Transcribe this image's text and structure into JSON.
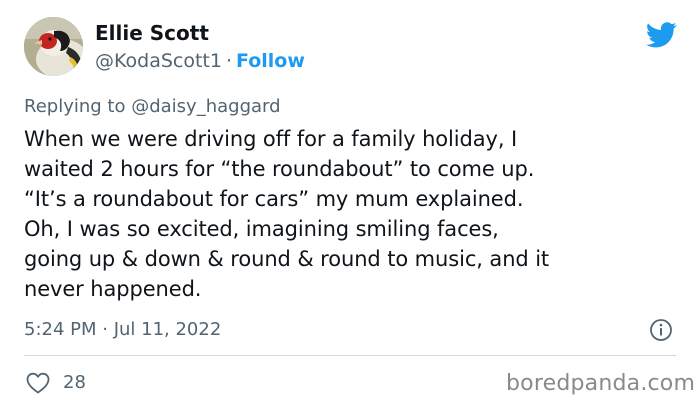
{
  "author": {
    "name": "Ellie Scott",
    "handle": "@KodaScott1",
    "separator": "·",
    "follow_label": "Follow",
    "avatar_icon": "goldfinch-avatar"
  },
  "platform_icon": "twitter-bird-icon",
  "reply": {
    "prefix": "Replying to",
    "mention": "@daisy_haggard"
  },
  "tweet": {
    "lines": [
      "When we were driving off for a family holiday, I",
      "waited 2 hours for “the roundabout” to come up.",
      "“It’s a roundabout for cars” my mum explained.",
      "Oh, I was so excited, imagining smiling faces,",
      "going up & down & round & round to music, and it",
      "never happened."
    ]
  },
  "meta": {
    "timestamp": "5:24 PM · Jul 11, 2022"
  },
  "stats": {
    "likes": "28"
  },
  "watermark": "boredpanda.com",
  "colors": {
    "accent": "#1d9bf0",
    "text": "#0f1419",
    "muted": "#536471",
    "divider": "#cfd9de"
  }
}
